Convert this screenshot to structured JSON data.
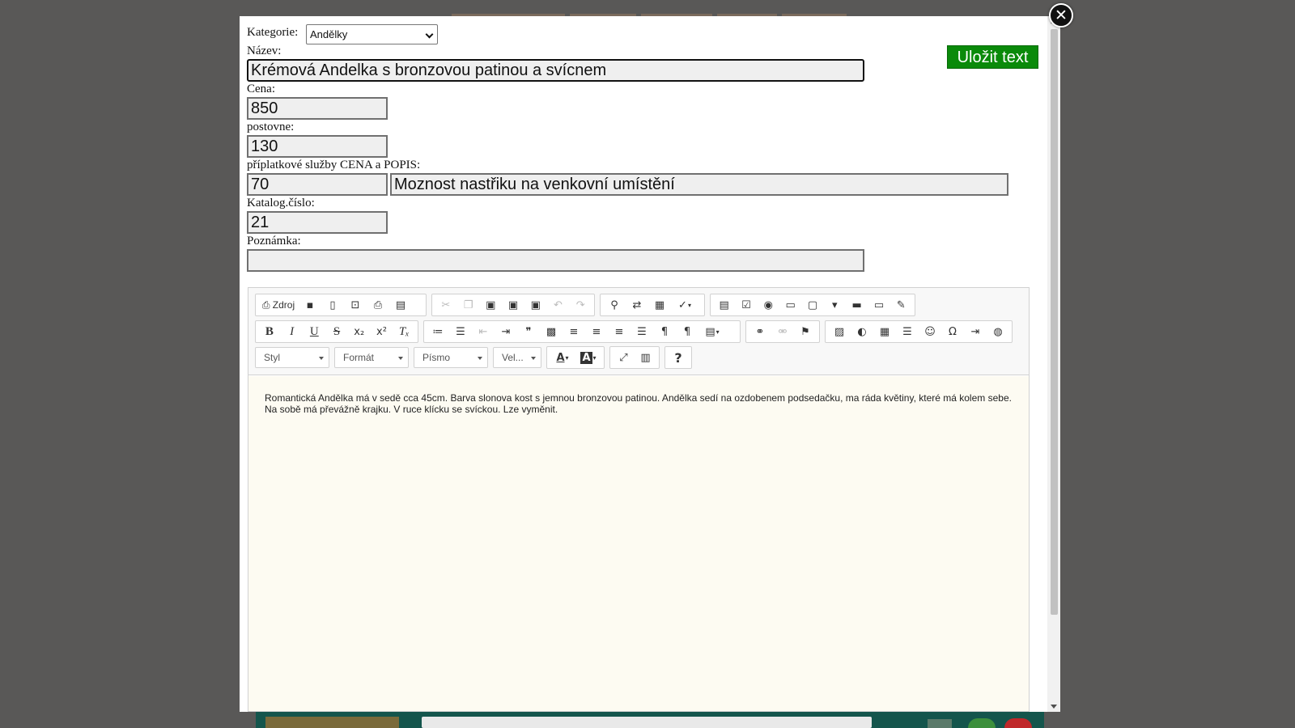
{
  "form": {
    "category_label": "Kategorie:",
    "category_value": "Andělky",
    "name_label": "Název:",
    "name_value": "Krémová Andelka s bronzovou patinou a svícnem",
    "price_label": "Cena:",
    "price_value": "850",
    "shipping_label": "postovne:",
    "shipping_value": "130",
    "extra_label": "příplatkové služby CENA a POPIS:",
    "extra_price_value": "70",
    "extra_desc_value": "Moznost nastřiku na venkovní umístění",
    "catalog_label": "Katalog.číslo:",
    "catalog_value": "21",
    "note_label": "Poznámka:",
    "note_value": "",
    "save_label": "Uložit text"
  },
  "editor": {
    "source_label": "Zdroj",
    "combos": {
      "style": "Styl",
      "format": "Formát",
      "font": "Písmo",
      "size": "Vel..."
    },
    "content": "Romantická Andělka má v sedě cca 45cm. Barva slonova kost s jemnou bronzovou patinou. Andělka sedí na ozdobenem podsedačku, ma ráda květiny, které má kolem sebe. Na sobě má převážně krajku. V ruce klícku se svíckou. Lze vyměnit."
  },
  "colors": {
    "save_button": "#0a8a0a",
    "overlay": "#595857",
    "editor_bg": "#fdfbf2"
  }
}
